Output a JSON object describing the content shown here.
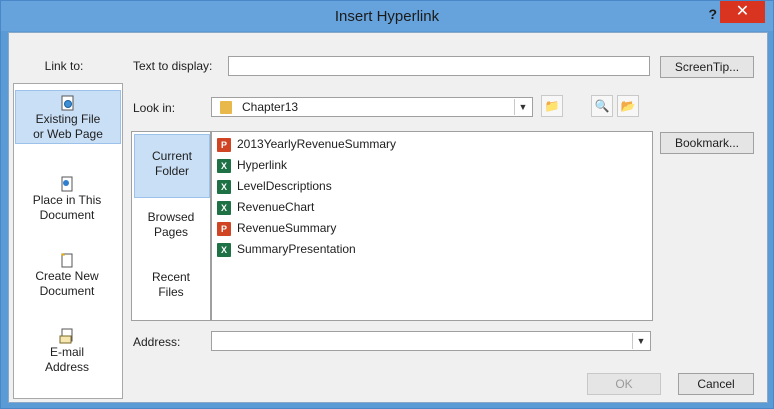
{
  "dialog": {
    "title": "Insert Hyperlink",
    "help_label": "?",
    "close_label": "✕"
  },
  "link_to": {
    "label": "Link to:",
    "items": [
      {
        "line1": "Existing File",
        "line2": "or Web Page",
        "icon": "document-globe-icon"
      },
      {
        "line1": "Place in This",
        "line2": "Document",
        "icon": "document-anchor-icon"
      },
      {
        "line1": "Create New",
        "line2": "Document",
        "icon": "new-document-icon"
      },
      {
        "line1": "E-mail",
        "line2": "Address",
        "icon": "email-icon"
      }
    ]
  },
  "text_to_display": {
    "label": "Text to display:",
    "value": ""
  },
  "screentip_button": "ScreenTip...",
  "look_in": {
    "label": "Look in:",
    "value": "Chapter13"
  },
  "nav": [
    {
      "line1": "Current",
      "line2": "Folder"
    },
    {
      "line1": "Browsed",
      "line2": "Pages"
    },
    {
      "line1": "Recent",
      "line2": "Files"
    }
  ],
  "files": [
    {
      "name": "2013YearlyRevenueSummary",
      "type": "ppt"
    },
    {
      "name": "Hyperlink",
      "type": "xls"
    },
    {
      "name": "LevelDescriptions",
      "type": "xls"
    },
    {
      "name": "RevenueChart",
      "type": "xls"
    },
    {
      "name": "RevenueSummary",
      "type": "ppt"
    },
    {
      "name": "SummaryPresentation",
      "type": "xls"
    }
  ],
  "bookmark_button": "Bookmark...",
  "address": {
    "label": "Address:",
    "value": ""
  },
  "ok_button": "OK",
  "cancel_button": "Cancel",
  "colors": {
    "titlebar": "#66a3dc",
    "close": "#d9341f",
    "selection": "#c9dff6"
  }
}
